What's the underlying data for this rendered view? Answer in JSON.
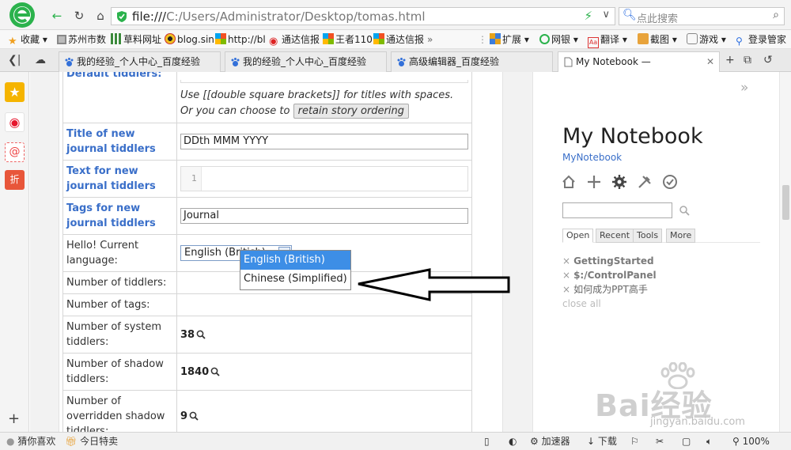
{
  "browser": {
    "address": {
      "prefix": "file:///",
      "path": "C:/Users/Administrator/Desktop/tomas.html"
    },
    "search_placeholder": "点此搜索"
  },
  "bookmarks": [
    {
      "label": "收藏",
      "icon": "star-icon"
    },
    {
      "label": "苏州市数",
      "icon": "site-icon"
    },
    {
      "label": "草料网址",
      "icon": "qr-icon"
    },
    {
      "label": "blog.sin",
      "icon": "eye-icon"
    },
    {
      "label": "http://bl",
      "icon": "windows-icon"
    },
    {
      "label": "通达信报",
      "icon": "security-icon"
    },
    {
      "label": "王者110",
      "icon": "windows-icon"
    },
    {
      "label": "通达信报",
      "icon": "windows-icon"
    }
  ],
  "bookmark_tools": [
    {
      "label": "扩展",
      "icon": "grid-icon"
    },
    {
      "label": "网银",
      "icon": "bank-icon"
    },
    {
      "label": "翻译",
      "icon": "translate-icon"
    },
    {
      "label": "截图",
      "icon": "scissors-icon"
    },
    {
      "label": "游戏",
      "icon": "gamepad-icon"
    },
    {
      "label": "登录管家",
      "icon": "search-key-icon"
    }
  ],
  "tabs": [
    {
      "label": "我的经验_个人中心_百度经验",
      "active": false
    },
    {
      "label": "我的经验_个人中心_百度经验",
      "active": false
    },
    {
      "label": "高级编辑器_百度经验",
      "active": false
    },
    {
      "label": "My Notebook —",
      "active": true
    }
  ],
  "settings": {
    "default_tiddlers_label": "Default tiddlers:",
    "default_tiddlers_hint": "Use [[double square brackets]] for titles with spaces. Or you can choose to",
    "retain_button": "retain story ordering",
    "title_journal_label": "Title of new journal tiddlers",
    "title_journal_value": "DDth MMM YYYY",
    "text_journal_label": "Text for new journal tiddlers",
    "text_journal_line": "1",
    "tags_journal_label": "Tags for new journal tiddlers",
    "tags_journal_value": "Journal",
    "language_label": "Hello! Current language:",
    "language_selected": "English (British)",
    "language_options": [
      "English (British)",
      "Chinese (Simplified)"
    ],
    "num_tiddlers_label": "Number of tiddlers:",
    "num_tags_label": "Number of tags:",
    "num_system_label": "Number of system tiddlers:",
    "num_system_value": "38",
    "num_shadow_label": "Number of shadow tiddlers:",
    "num_shadow_value": "1840",
    "num_overridden_label": "Number of overridden shadow tiddlers:",
    "num_overridden_value": "9"
  },
  "notebook": {
    "title": "My Notebook",
    "subtitle": "MyNotebook",
    "tabs": [
      "Open",
      "Recent",
      "Tools",
      "More"
    ],
    "open_items": [
      "GettingStarted",
      "$:/ControlPanel",
      "如何成为PPT高手"
    ],
    "close_all": "close all"
  },
  "watermark": {
    "brand": "Bai经验",
    "url": "jingyan.baidu.com"
  },
  "statusbar": {
    "guess": "猜你喜欢",
    "deals": "今日特卖",
    "accelerator": "加速器",
    "download": "下载",
    "zoom": "100%"
  },
  "colors": {
    "accent_green": "#2bb24c",
    "link_blue": "#3a6fc9",
    "selection_blue": "#3d8ee6"
  }
}
